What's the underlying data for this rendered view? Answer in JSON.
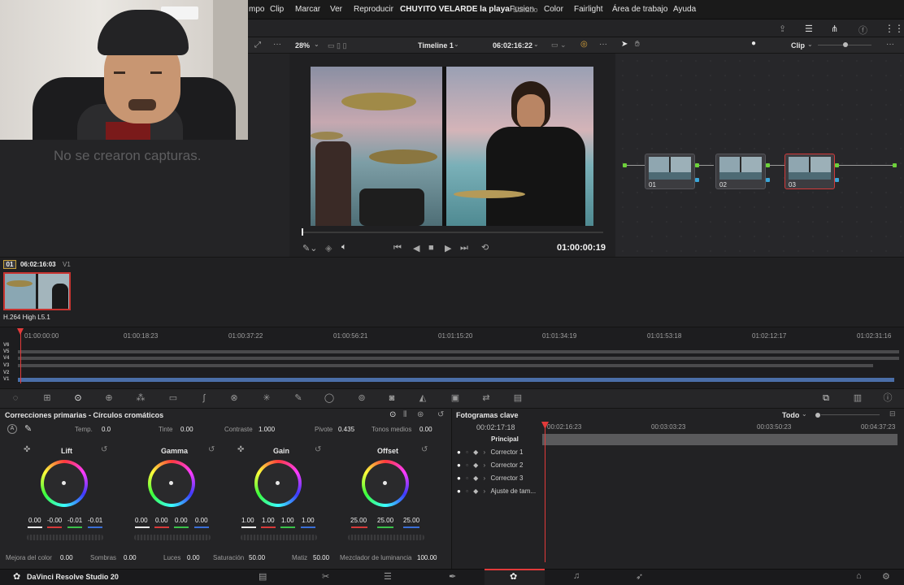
{
  "menubar": {
    "items": [
      "mpo",
      "Clip",
      "Marcar",
      "Ver",
      "Reproducir",
      "Fusion",
      "Color",
      "Fairlight",
      "Área de trabajo",
      "Ayuda"
    ]
  },
  "titlebar": {
    "project_title": "CHUYITO VELARDE la playa",
    "status": "Editado"
  },
  "gallery": {
    "empty_message": "No se crearon capturas."
  },
  "viewer": {
    "zoom": "28%",
    "timeline_name": "Timeline 1",
    "source_timecode": "06:02:16:22",
    "timecode": "01:00:00:19"
  },
  "node_editor": {
    "mode": "Clip",
    "nodes": [
      {
        "label": "01",
        "active": false
      },
      {
        "label": "02",
        "active": false
      },
      {
        "label": "03",
        "active": true
      }
    ]
  },
  "clips": {
    "index": "01",
    "timecode": "06:02:16:03",
    "track": "V1",
    "codec": "H.264 High L5.1"
  },
  "timeline": {
    "ticks": [
      "01:00:00:00",
      "01:00:18:23",
      "01:00:37:22",
      "01:00:56:21",
      "01:01:15:20",
      "01:01:34:19",
      "01:01:53:18",
      "01:02:12:17",
      "01:02:31:16"
    ],
    "tracks": [
      "V6",
      "V5",
      "V4",
      "V3",
      "V2",
      "V1"
    ]
  },
  "primaries": {
    "title": "Correcciones primarias - Círculos cromáticos",
    "top_params": [
      {
        "label": "Temp.",
        "value": "0.0"
      },
      {
        "label": "Tinte",
        "value": "0.00"
      },
      {
        "label": "Contraste",
        "value": "1.000"
      },
      {
        "label": "Pivote",
        "value": "0.435"
      },
      {
        "label": "Tonos medios",
        "value": "0.00"
      }
    ],
    "wheels": [
      {
        "name": "Lift",
        "values": [
          "0.00",
          "-0.00",
          "-0.01",
          "-0.01"
        ]
      },
      {
        "name": "Gamma",
        "values": [
          "0.00",
          "0.00",
          "0.00",
          "0.00"
        ]
      },
      {
        "name": "Gain",
        "values": [
          "1.00",
          "1.00",
          "1.00",
          "1.00"
        ]
      },
      {
        "name": "Offset",
        "values": [
          "25.00",
          "25.00",
          "25.00"
        ]
      }
    ],
    "bottom_params": [
      {
        "label": "Mejora del color",
        "value": "0.00"
      },
      {
        "label": "Sombras",
        "value": "0.00"
      },
      {
        "label": "Luces",
        "value": "0.00"
      },
      {
        "label": "Saturación",
        "value": "50.00"
      },
      {
        "label": "Matiz",
        "value": "50.00"
      },
      {
        "label": "Mezclador de luminancia",
        "value": "100.00"
      }
    ]
  },
  "keyframes": {
    "title": "Fotogramas clave",
    "filter": "Todo",
    "timecode": "00:02:17:18",
    "ticks": [
      "00:02:16:23",
      "00:03:03:23",
      "00:03:50:23",
      "00:04:37:23"
    ],
    "rows": [
      "Principal",
      "Corrector 1",
      "Corrector 2",
      "Corrector 3",
      "Ajuste de tam..."
    ]
  },
  "bottombar": {
    "app_name": "DaVinci Resolve Studio 20"
  }
}
